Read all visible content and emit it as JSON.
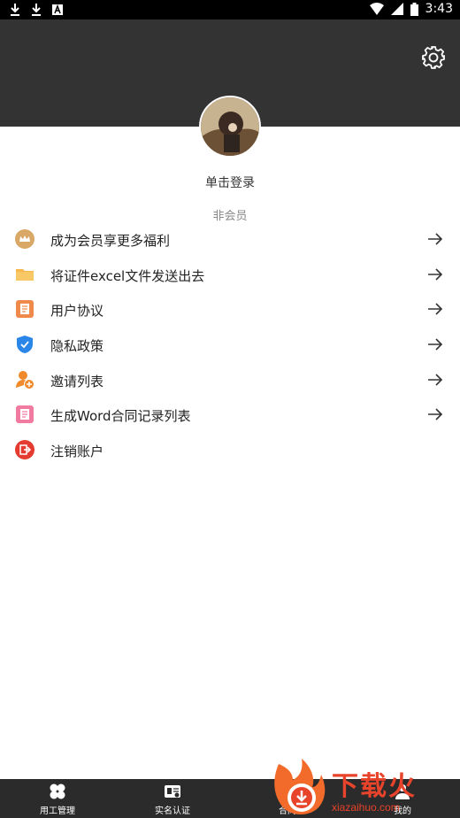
{
  "status_bar": {
    "time": "3:43",
    "left_icons": [
      "download-icon",
      "download-icon",
      "font-a-icon"
    ],
    "right_icons": [
      "wifi-icon",
      "signal-icon",
      "battery-icon"
    ]
  },
  "header": {
    "settings_icon": "gear-icon",
    "background": "#333333"
  },
  "profile": {
    "login_text": "单击登录",
    "membership_status": "非会员"
  },
  "menu": {
    "items": [
      {
        "label": "成为会员享更多福利",
        "icon": "crown-icon",
        "has_arrow": true,
        "icon_color": "#d9a867"
      },
      {
        "label": "将证件excel文件发送出去",
        "icon": "folder-icon",
        "has_arrow": true,
        "icon_color": "#f5b84a"
      },
      {
        "label": "用户协议",
        "icon": "document-icon",
        "has_arrow": true,
        "icon_color": "#f08a4b"
      },
      {
        "label": "隐私政策",
        "icon": "shield-icon",
        "has_arrow": true,
        "icon_color": "#2a86e8"
      },
      {
        "label": "邀请列表",
        "icon": "add-user-icon",
        "has_arrow": true,
        "icon_color": "#f08a2b"
      },
      {
        "label": "生成Word合同记录列表",
        "icon": "record-icon",
        "has_arrow": true,
        "icon_color": "#f07aa0"
      },
      {
        "label": "注销账户",
        "icon": "logout-icon",
        "has_arrow": false,
        "icon_color": "#e53a2f"
      }
    ]
  },
  "tabbar": {
    "tabs": [
      {
        "label": "用工管理",
        "icon": "grid-icon"
      },
      {
        "label": "实名认证",
        "icon": "id-card-icon"
      },
      {
        "label": "合同",
        "icon": "contract-icon"
      },
      {
        "label": "我的",
        "icon": "user-icon"
      }
    ]
  },
  "watermark": {
    "brand": "下载火",
    "url": "xiazaihuo.com"
  }
}
